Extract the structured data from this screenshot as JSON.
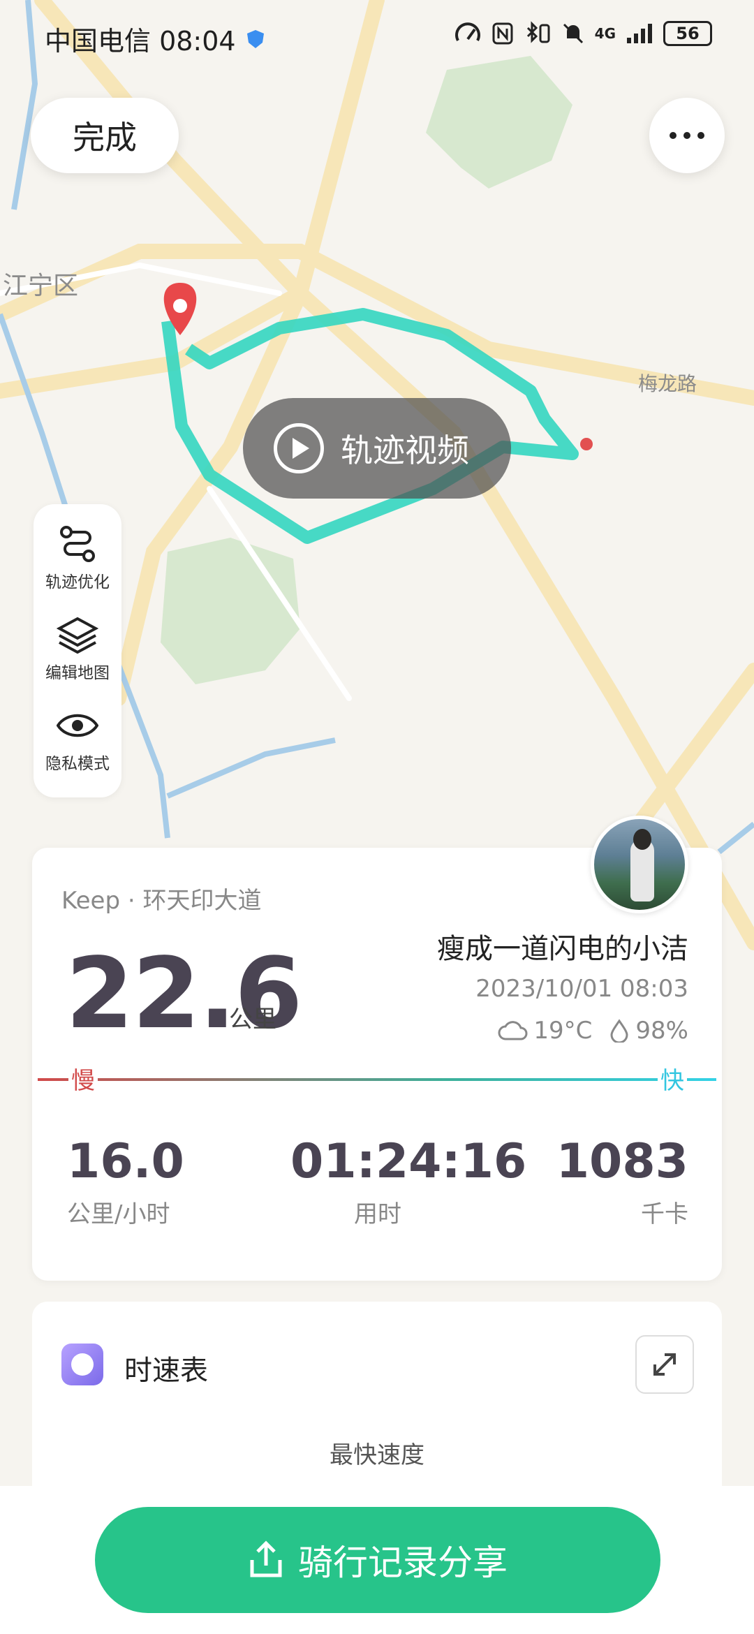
{
  "status_bar": {
    "carrier_time": "中国电信 08:04",
    "network": "4G",
    "battery": "56",
    "icons": [
      "shield-icon",
      "speed-icon",
      "nfc-icon",
      "bluetooth-icon",
      "mute-icon",
      "signal-icon",
      "battery-icon"
    ]
  },
  "header": {
    "done_label": "完成",
    "more_icon": "more-dots-icon"
  },
  "map": {
    "labels": [
      "江宁区",
      "梅龙路"
    ],
    "track_video_label": "轨迹视频"
  },
  "side_tools": [
    {
      "label": "轨迹优化",
      "icon": "route-icon"
    },
    {
      "label": "编辑地图",
      "icon": "layers-icon"
    },
    {
      "label": "隐私模式",
      "icon": "eye-icon"
    }
  ],
  "summary": {
    "source": "Keep · 环天印大道",
    "distance": "22.6",
    "distance_unit": "公里",
    "username": "瘦成一道闪电的小洁",
    "datetime": "2023/10/01 08:03",
    "temperature": "19°C",
    "humidity": "98%",
    "slow_label": "慢",
    "fast_label": "快",
    "stats": [
      {
        "value": "16.0",
        "label": "公里/小时"
      },
      {
        "value": "01:24:16",
        "label": "用时"
      },
      {
        "value": "1083",
        "label": "千卡"
      }
    ]
  },
  "speedometer": {
    "title": "时速表",
    "fastest_label": "最快速度"
  },
  "share": {
    "label": "骑行记录分享"
  },
  "colors": {
    "accent": "#27c48a",
    "track": "#33d2c6",
    "slow": "#d24a4a",
    "fast": "#33c6e0"
  }
}
